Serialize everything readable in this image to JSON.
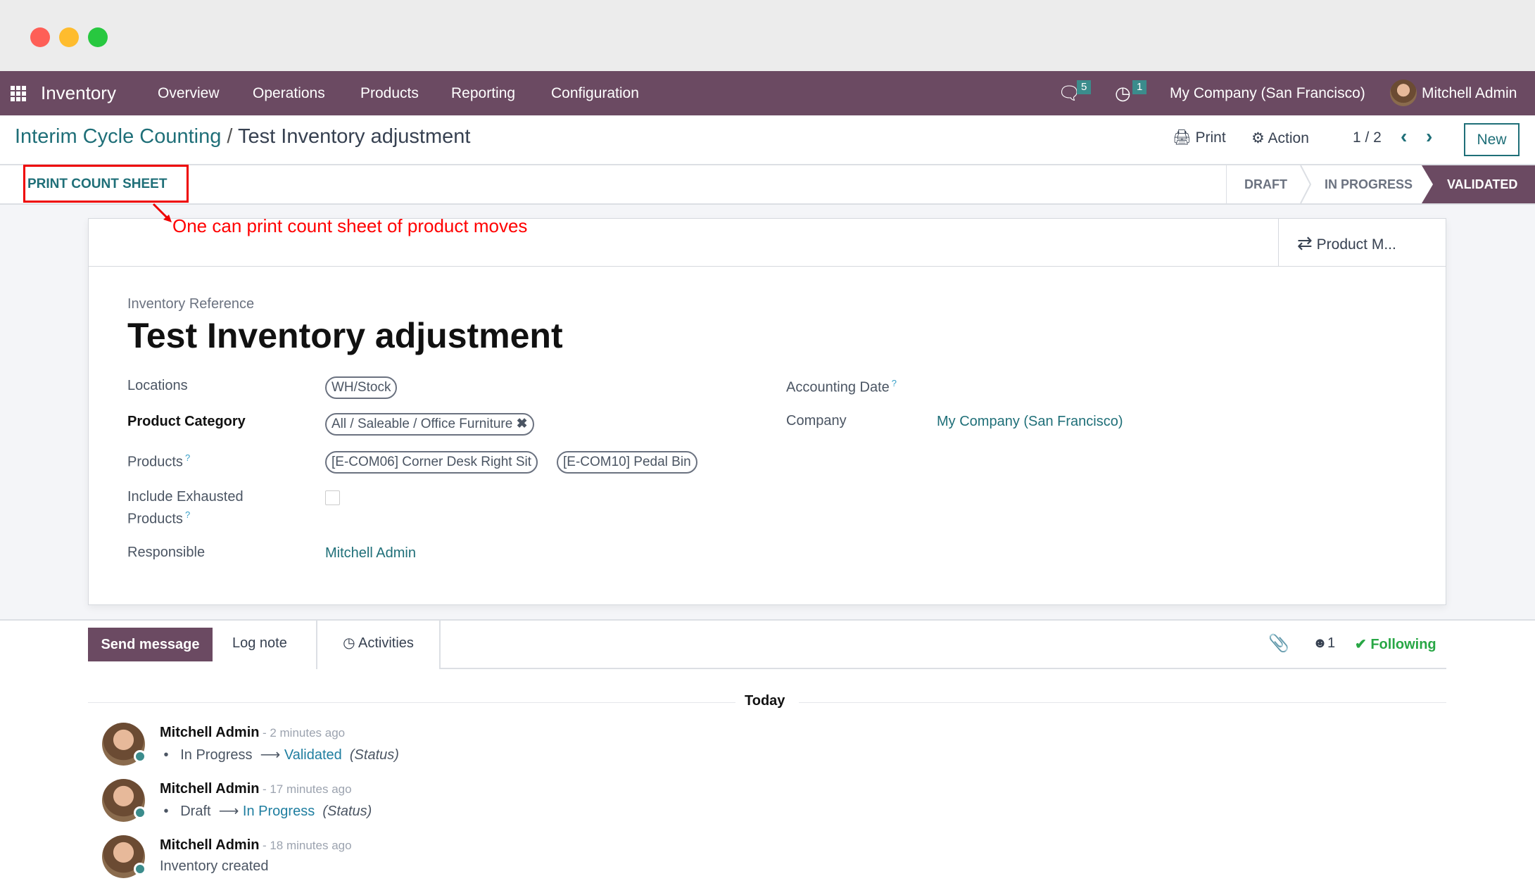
{
  "colors": {
    "brand": "#6b4a62",
    "accent": "#1f6f78",
    "annotation": "#ff0000",
    "following": "#28a745"
  },
  "nav": {
    "app": "Inventory",
    "menu": [
      "Overview",
      "Operations",
      "Products",
      "Reporting",
      "Configuration"
    ],
    "messages_count": "5",
    "activities_count": "1",
    "company": "My Company (San Francisco)",
    "user": "Mitchell Admin"
  },
  "control": {
    "breadcrumb_parent": "Interim Cycle Counting",
    "breadcrumb_sep": "/",
    "breadcrumb_current": "Test Inventory adjustment",
    "print": "Print",
    "action": "Action",
    "pager": "1 / 2",
    "new": "New"
  },
  "statusbar": {
    "button": "PRINT COUNT SHEET",
    "stages": [
      "DRAFT",
      "IN PROGRESS",
      "VALIDATED"
    ],
    "current": "VALIDATED"
  },
  "annotation": "One can print count sheet of product moves",
  "form": {
    "smart_button": "Product M...",
    "ref_label": "Inventory Reference",
    "title": "Test Inventory adjustment",
    "locations_label": "Locations",
    "locations": [
      "WH/Stock"
    ],
    "category_label": "Product Category",
    "category": "All / Saleable / Office Furniture",
    "products_label": "Products",
    "products": [
      "[E-COM06] Corner Desk Right Sit",
      "[E-COM10] Pedal Bin"
    ],
    "exhausted_label_1": "Include Exhausted",
    "exhausted_label_2": "Products",
    "exhausted": false,
    "responsible_label": "Responsible",
    "responsible": "Mitchell Admin",
    "accounting_date_label": "Accounting Date",
    "company_label": "Company",
    "company": "My Company (San Francisco)"
  },
  "chatter": {
    "send": "Send message",
    "log": "Log note",
    "activities": "Activities",
    "followers": "1",
    "following": "Following",
    "today": "Today",
    "messages": [
      {
        "author": "Mitchell Admin",
        "ago": "- 2 minutes ago",
        "from": "In Progress",
        "to": "Validated",
        "field": "(Status)"
      },
      {
        "author": "Mitchell Admin",
        "ago": "- 17 minutes ago",
        "from": "Draft",
        "to": "In Progress",
        "field": "(Status)"
      },
      {
        "author": "Mitchell Admin",
        "ago": "- 18 minutes ago",
        "text": "Inventory created"
      }
    ]
  }
}
